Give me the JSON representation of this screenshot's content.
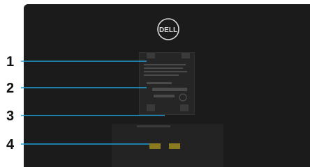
{
  "brand": {
    "logo_text": "DELL"
  },
  "callouts": [
    {
      "number": "1"
    },
    {
      "number": "2"
    },
    {
      "number": "3"
    },
    {
      "number": "4"
    }
  ],
  "colors": {
    "monitor_body": "#1b1b1b",
    "callout_line": "#1f9fd8",
    "label_text": "#111111",
    "logo": "#d8d8d8"
  }
}
